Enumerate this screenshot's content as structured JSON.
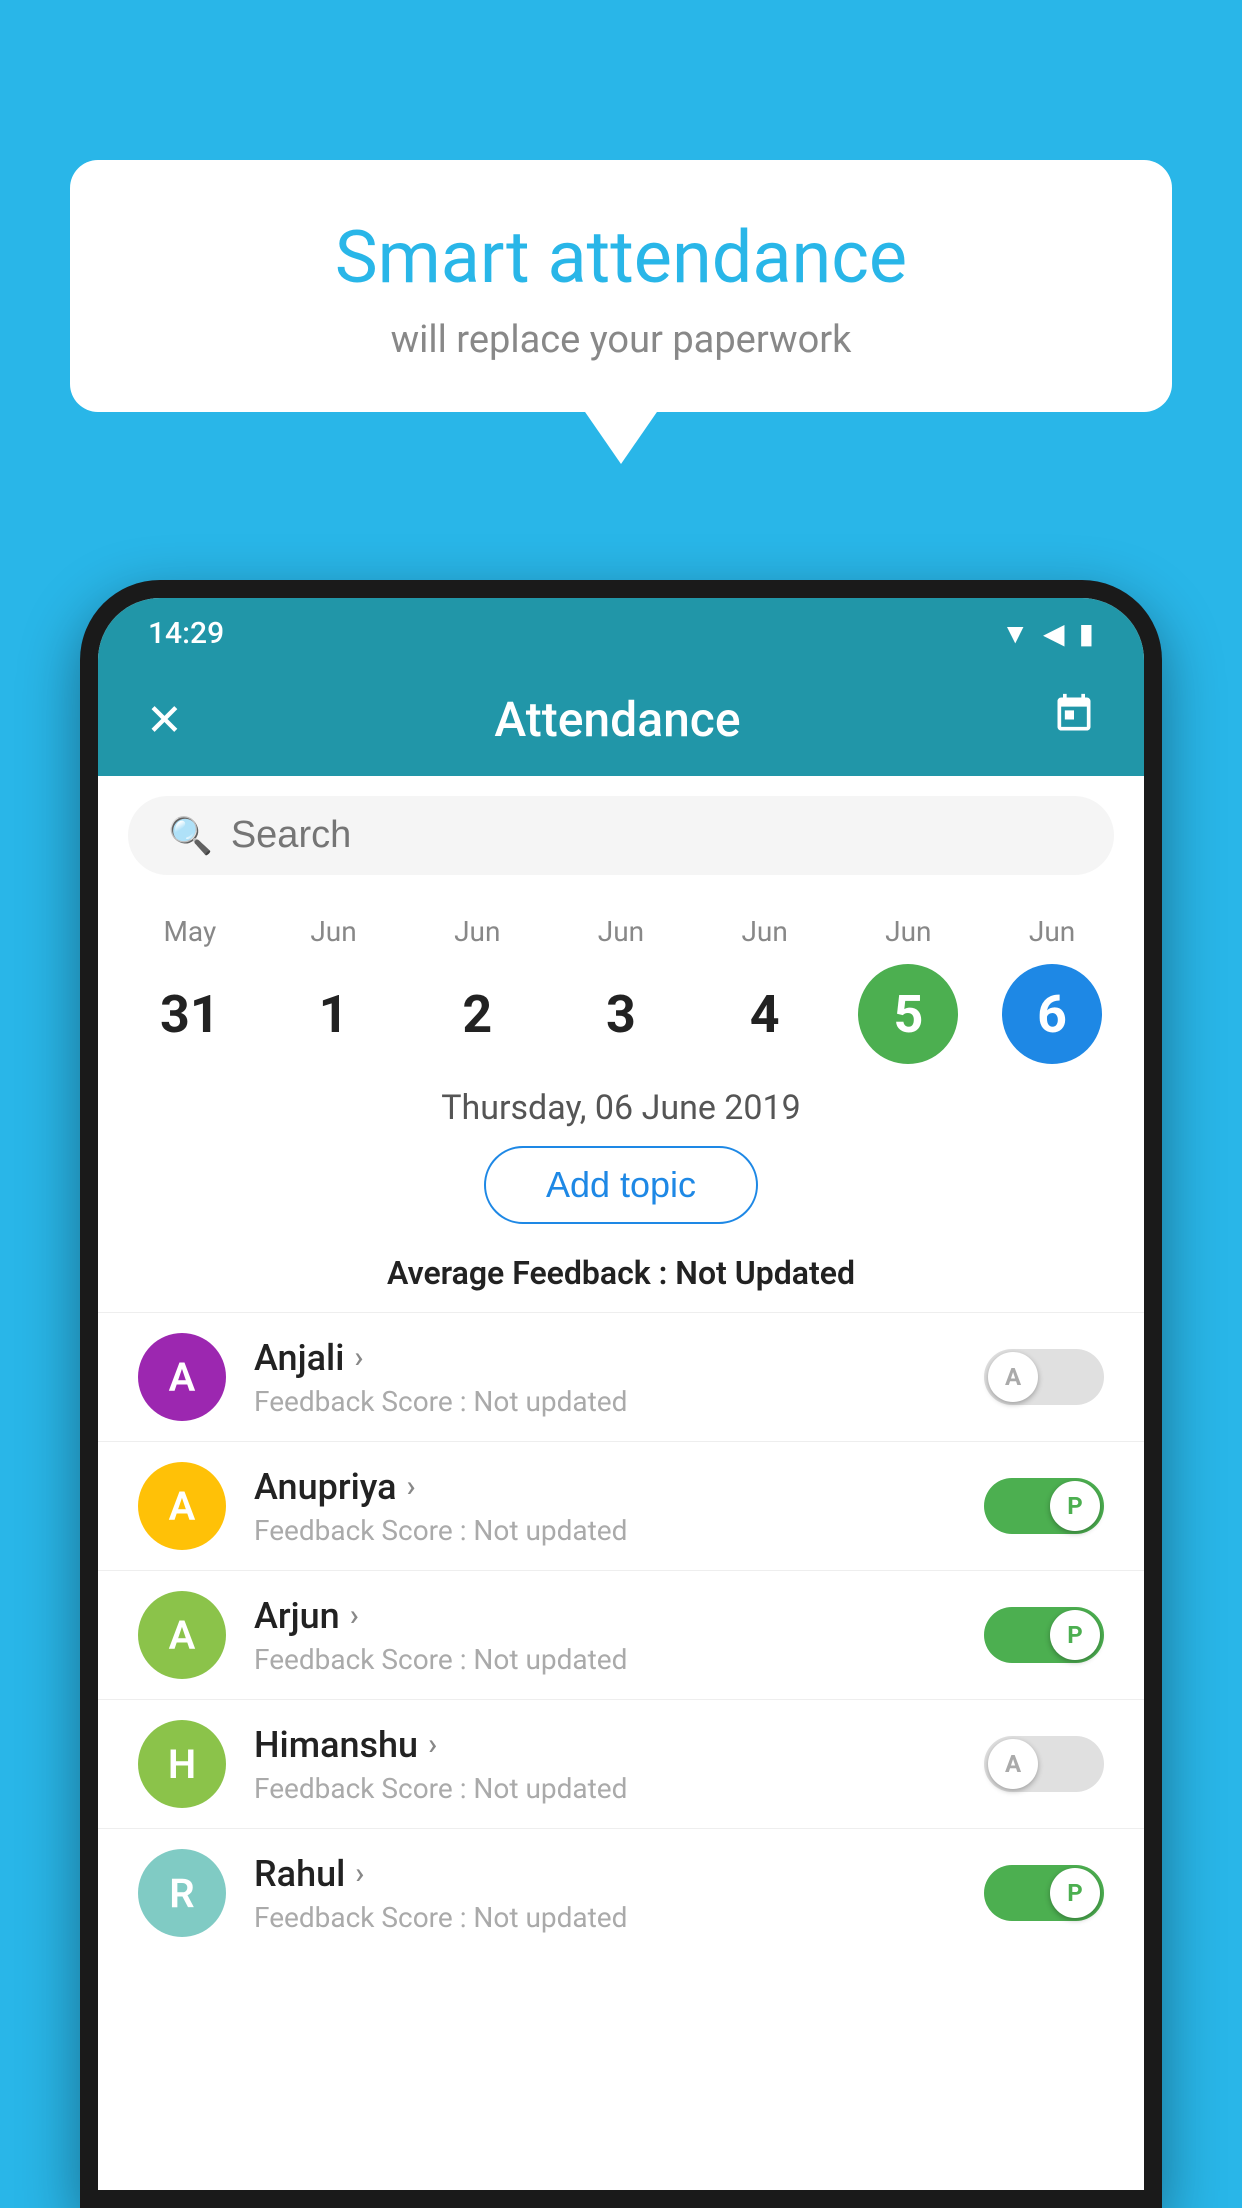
{
  "background_color": "#29b6e8",
  "speech_bubble": {
    "title": "Smart attendance",
    "subtitle": "will replace your paperwork"
  },
  "status_bar": {
    "time": "14:29",
    "icons": "▼◀▮"
  },
  "app_bar": {
    "title": "Attendance",
    "close_icon": "✕",
    "calendar_icon": "📅"
  },
  "search": {
    "placeholder": "Search"
  },
  "calendar": {
    "days": [
      {
        "month": "May",
        "number": "31",
        "style": "normal"
      },
      {
        "month": "Jun",
        "number": "1",
        "style": "normal"
      },
      {
        "month": "Jun",
        "number": "2",
        "style": "normal"
      },
      {
        "month": "Jun",
        "number": "3",
        "style": "normal"
      },
      {
        "month": "Jun",
        "number": "4",
        "style": "normal"
      },
      {
        "month": "Jun",
        "number": "5",
        "style": "green"
      },
      {
        "month": "Jun",
        "number": "6",
        "style": "blue"
      }
    ]
  },
  "selected_date": "Thursday, 06 June 2019",
  "add_topic_label": "Add topic",
  "avg_feedback_label": "Average Feedback :",
  "avg_feedback_value": "Not Updated",
  "students": [
    {
      "name": "Anjali",
      "avatar_letter": "A",
      "avatar_color": "purple",
      "feedback_label": "Feedback Score :",
      "feedback_value": "Not updated",
      "toggle": "off",
      "toggle_letter": "A"
    },
    {
      "name": "Anupriya",
      "avatar_letter": "A",
      "avatar_color": "yellow",
      "feedback_label": "Feedback Score :",
      "feedback_value": "Not updated",
      "toggle": "on",
      "toggle_letter": "P"
    },
    {
      "name": "Arjun",
      "avatar_letter": "A",
      "avatar_color": "light-green",
      "feedback_label": "Feedback Score :",
      "feedback_value": "Not updated",
      "toggle": "on",
      "toggle_letter": "P"
    },
    {
      "name": "Himanshu",
      "avatar_letter": "H",
      "avatar_color": "light-green",
      "feedback_label": "Feedback Score :",
      "feedback_value": "Not updated",
      "toggle": "off",
      "toggle_letter": "A"
    },
    {
      "name": "Rahul",
      "avatar_letter": "R",
      "avatar_color": "teal",
      "feedback_label": "Feedback Score :",
      "feedback_value": "Not updated",
      "toggle": "on",
      "toggle_letter": "P"
    }
  ]
}
